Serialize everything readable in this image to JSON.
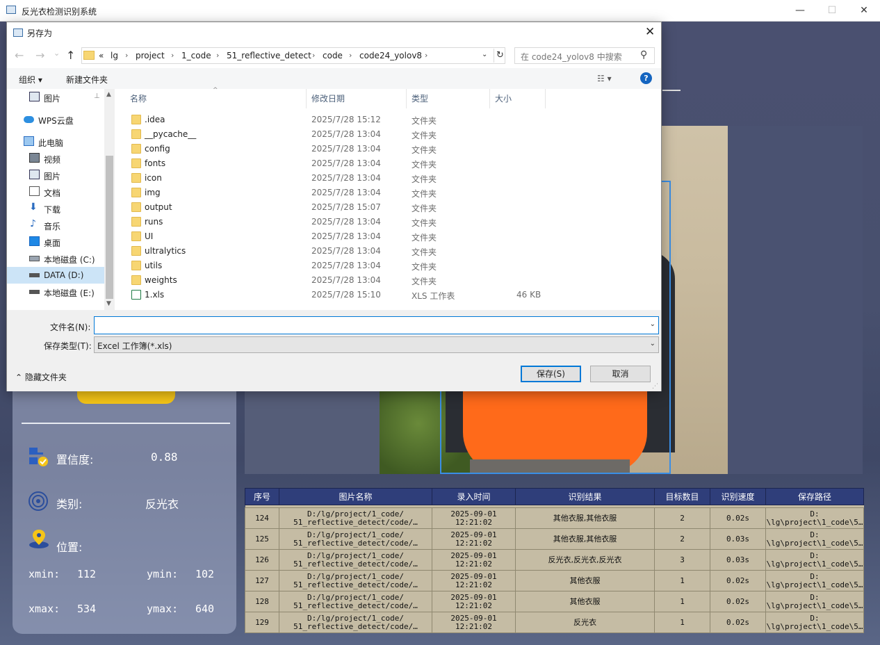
{
  "main_window": {
    "title": "反光衣检测识别系统",
    "min": "—",
    "max": "☐",
    "close": "✕"
  },
  "info_panel": {
    "confidence_label": "置信度:",
    "confidence_value": "0.88",
    "class_label": "类别:",
    "class_value": "反光衣",
    "position_label": "位置:",
    "xmin_label": "xmin:",
    "xmin_value": "112",
    "ymin_label": "ymin:",
    "ymin_value": "102",
    "xmax_label": "xmax:",
    "xmax_value": "534",
    "ymax_label": "ymax:",
    "ymax_value": "640"
  },
  "results_table": {
    "headers": [
      "序号",
      "图片名称",
      "录入时间",
      "识别结果",
      "目标数目",
      "识别速度",
      "保存路径"
    ],
    "rows": [
      {
        "id": "124",
        "name1": "D:/lg/project/1_code/",
        "name2": "51_reflective_detect/code/…",
        "date": "2025-09-01",
        "time": "12:21:02",
        "result": "其他衣服,其他衣服",
        "count": "2",
        "speed": "0.02s",
        "path1": "D:",
        "path2": "\\lg\\project\\1_code\\5…"
      },
      {
        "id": "125",
        "name1": "D:/lg/project/1_code/",
        "name2": "51_reflective_detect/code/…",
        "date": "2025-09-01",
        "time": "12:21:02",
        "result": "其他衣服,其他衣服",
        "count": "2",
        "speed": "0.03s",
        "path1": "D:",
        "path2": "\\lg\\project\\1_code\\5…"
      },
      {
        "id": "126",
        "name1": "D:/lg/project/1_code/",
        "name2": "51_reflective_detect/code/…",
        "date": "2025-09-01",
        "time": "12:21:02",
        "result": "反光衣,反光衣,反光衣",
        "count": "3",
        "speed": "0.03s",
        "path1": "D:",
        "path2": "\\lg\\project\\1_code\\5…"
      },
      {
        "id": "127",
        "name1": "D:/lg/project/1_code/",
        "name2": "51_reflective_detect/code/…",
        "date": "2025-09-01",
        "time": "12:21:02",
        "result": "其他衣服",
        "count": "1",
        "speed": "0.02s",
        "path1": "D:",
        "path2": "\\lg\\project\\1_code\\5…"
      },
      {
        "id": "128",
        "name1": "D:/lg/project/1_code/",
        "name2": "51_reflective_detect/code/…",
        "date": "2025-09-01",
        "time": "12:21:02",
        "result": "其他衣服",
        "count": "1",
        "speed": "0.02s",
        "path1": "D:",
        "path2": "\\lg\\project\\1_code\\5…"
      },
      {
        "id": "129",
        "name1": "D:/lg/project/1_code/",
        "name2": "51_reflective_detect/code/…",
        "date": "2025-09-01",
        "time": "12:21:02",
        "result": "反光衣",
        "count": "1",
        "speed": "0.02s",
        "path1": "D:",
        "path2": "\\lg\\project\\1_code\\5…"
      }
    ]
  },
  "dialog": {
    "title": "另存为",
    "close": "✕",
    "nav": {
      "back": "←",
      "forward": "→",
      "recent": "⌄",
      "up": "↑"
    },
    "breadcrumb": [
      "«",
      "lg",
      "project",
      "1_code",
      "51_reflective_detect",
      "code",
      "code24_yolov8"
    ],
    "search_placeholder": "在 code24_yolov8 中搜索",
    "toolbar": {
      "organize": "组织 ▾",
      "new_folder": "新建文件夹",
      "help": "?"
    },
    "sidebar": [
      {
        "label": "图片",
        "icon": "pictures-icon",
        "pinned": "📌"
      },
      {
        "label": "WPS云盘",
        "icon": "cloud-icon"
      },
      {
        "label": "此电脑",
        "icon": "computer-icon"
      },
      {
        "label": "视频",
        "icon": "video-icon"
      },
      {
        "label": "图片",
        "icon": "pictures-icon"
      },
      {
        "label": "文档",
        "icon": "documents-icon"
      },
      {
        "label": "下载",
        "icon": "download-icon"
      },
      {
        "label": "音乐",
        "icon": "music-icon"
      },
      {
        "label": "桌面",
        "icon": "desktop-icon"
      },
      {
        "label": "本地磁盘 (C:)",
        "icon": "drive-icon"
      },
      {
        "label": "DATA (D:)",
        "icon": "drive-icon"
      },
      {
        "label": "本地磁盘 (E:)",
        "icon": "drive-icon"
      }
    ],
    "columns": {
      "name": "名称",
      "date": "修改日期",
      "type": "类型",
      "size": "大小"
    },
    "files": [
      {
        "name": ".idea",
        "date": "2025/7/28 15:12",
        "type": "文件夹",
        "size": ""
      },
      {
        "name": "__pycache__",
        "date": "2025/7/28 13:04",
        "type": "文件夹",
        "size": ""
      },
      {
        "name": "config",
        "date": "2025/7/28 13:04",
        "type": "文件夹",
        "size": ""
      },
      {
        "name": "fonts",
        "date": "2025/7/28 13:04",
        "type": "文件夹",
        "size": ""
      },
      {
        "name": "icon",
        "date": "2025/7/28 13:04",
        "type": "文件夹",
        "size": ""
      },
      {
        "name": "img",
        "date": "2025/7/28 13:04",
        "type": "文件夹",
        "size": ""
      },
      {
        "name": "output",
        "date": "2025/7/28 15:07",
        "type": "文件夹",
        "size": ""
      },
      {
        "name": "runs",
        "date": "2025/7/28 13:04",
        "type": "文件夹",
        "size": ""
      },
      {
        "name": "UI",
        "date": "2025/7/28 13:04",
        "type": "文件夹",
        "size": ""
      },
      {
        "name": "ultralytics",
        "date": "2025/7/28 13:04",
        "type": "文件夹",
        "size": ""
      },
      {
        "name": "utils",
        "date": "2025/7/28 13:04",
        "type": "文件夹",
        "size": ""
      },
      {
        "name": "weights",
        "date": "2025/7/28 13:04",
        "type": "文件夹",
        "size": ""
      },
      {
        "name": "1.xls",
        "date": "2025/7/28 15:10",
        "type": "XLS 工作表",
        "size": "46 KB"
      }
    ],
    "filename_label": "文件名(N):",
    "filename_value": "",
    "filetype_label": "保存类型(T):",
    "filetype_value": "Excel 工作簿(*.xls)",
    "hide_folders": "隐藏文件夹",
    "save_button": "保存(S)",
    "cancel_button": "取消"
  },
  "colors": {
    "accent_blue": "#0078d7",
    "table_header": "#2f3e7a",
    "table_cell": "#c5bca4",
    "export_button": "#f5c518",
    "bbox": "#3a8ee6",
    "vest": "#ff6a1a"
  }
}
